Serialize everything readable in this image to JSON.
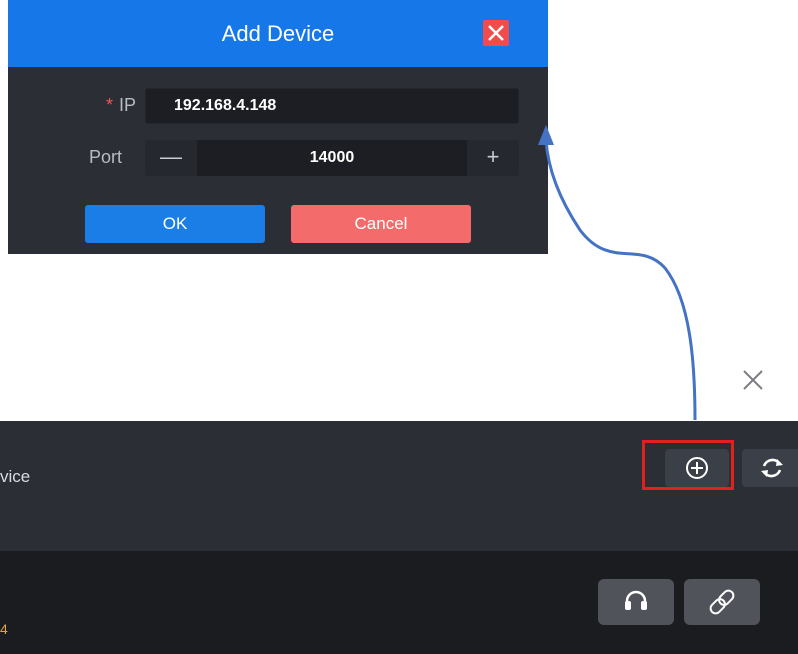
{
  "dialog": {
    "title": "Add Device",
    "ip_label": "IP",
    "required_mark": "*",
    "ip_value": "192.168.4.148",
    "port_label": "Port",
    "port_value": "14000",
    "minus_glyph": "—",
    "plus_glyph": "+",
    "ok_label": "OK",
    "cancel_label": "Cancel",
    "close_icon": "close-icon",
    "header_color": "#1677e8",
    "ok_color": "#1a7ee6",
    "cancel_color": "#f36b6b"
  },
  "panel": {
    "device_title_fragment": "vice",
    "row_value_fragment": "4",
    "add_icon": "add-circle-icon",
    "refresh_icon": "refresh-icon",
    "headset_icon": "headset-icon",
    "link_icon": "link-icon",
    "close_icon": "close-icon",
    "highlight_color": "#e0211d",
    "arrow_color": "#4472c4"
  }
}
